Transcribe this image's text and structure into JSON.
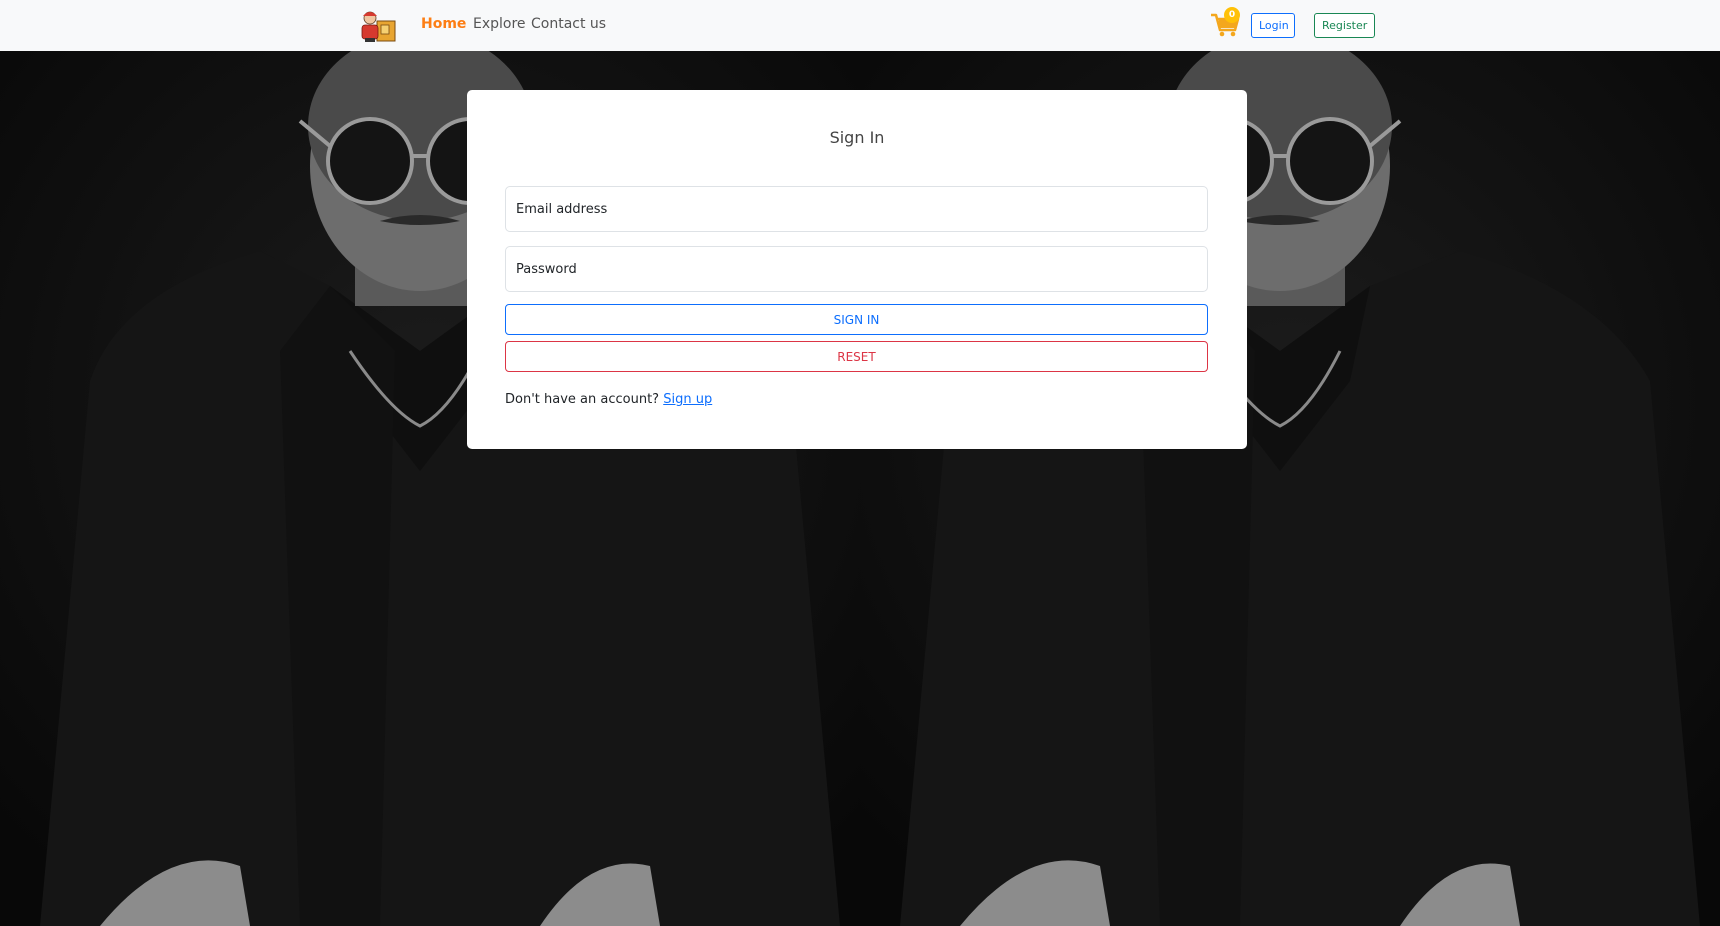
{
  "navbar": {
    "logo_icon": "delivery-man-logo-icon",
    "links": [
      {
        "id": "home",
        "label": "Home",
        "active": true
      },
      {
        "id": "explore",
        "label": "Explore",
        "active": false
      },
      {
        "id": "contact",
        "label": "Contact us",
        "active": false
      }
    ],
    "cart_icon": "shopping-cart-icon",
    "cart_count": "0",
    "login_label": "Login",
    "register_label": "Register"
  },
  "signin": {
    "title": "Sign In",
    "email_placeholder": "Email address",
    "password_placeholder": "Password",
    "signin_label": "SIGN IN",
    "reset_label": "RESET",
    "no_account_text": "Don't have an account?",
    "signup_label": "Sign up"
  },
  "colors": {
    "accent": "#fd7e14",
    "primary": "#0d6efd",
    "danger": "#dc3545",
    "success": "#198754",
    "badge": "#ffc107",
    "navbar_bg": "#f8f9fa"
  }
}
